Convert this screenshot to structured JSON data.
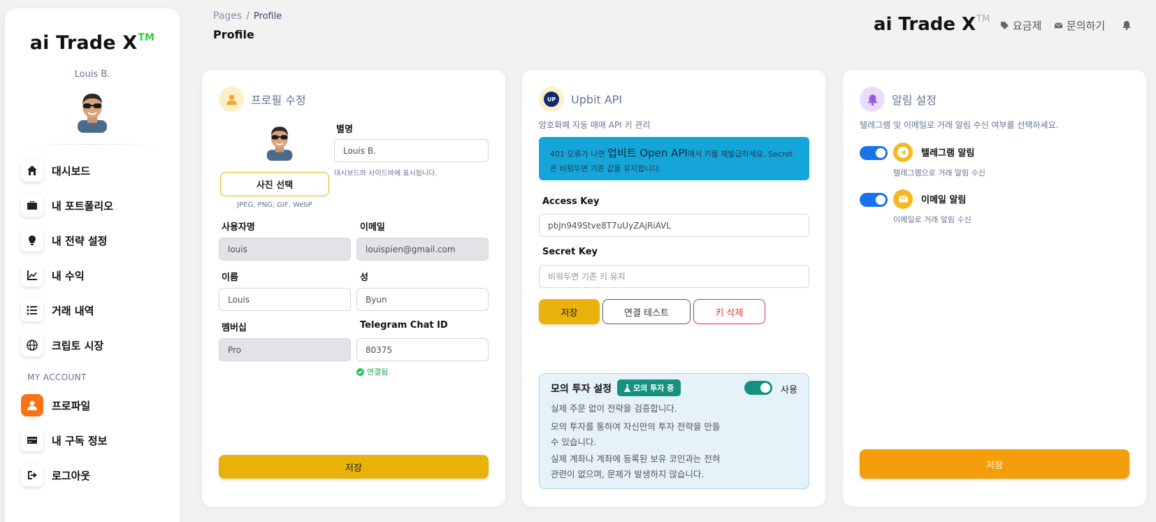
{
  "sidebar": {
    "brand": "ai Trade X",
    "brand_tm": "TM",
    "user_name": "Louis B.",
    "nav": [
      {
        "label": "대시보드",
        "icon": "home-icon"
      },
      {
        "label": "내 포트폴리오",
        "icon": "briefcase-icon"
      },
      {
        "label": "내 전략 설정",
        "icon": "lightbulb-icon"
      },
      {
        "label": "내 수익",
        "icon": "chart-line-icon"
      },
      {
        "label": "거래 내역",
        "icon": "list-icon"
      },
      {
        "label": "크립토 시장",
        "icon": "globe-icon"
      }
    ],
    "section": "MY ACCOUNT",
    "account": [
      {
        "label": "프로파일",
        "icon": "user-icon",
        "active": true
      },
      {
        "label": "내 구독 정보",
        "icon": "credit-card-icon"
      },
      {
        "label": "로그아웃",
        "icon": "logout-icon"
      }
    ]
  },
  "header": {
    "crumb_root": "Pages",
    "crumb_sep": "/",
    "crumb_current": "Profile",
    "page_title": "Profile",
    "brand": "ai Trade X",
    "brand_tm": "TM",
    "pricing": "요금제",
    "contact": "문의하기"
  },
  "profile": {
    "title": "프로필 수정",
    "nickname_label": "별명",
    "nickname_value": "Louis B.",
    "nickname_hint": "대시보드와 사이드바에 표시됩니다.",
    "photo_button": "사진 선택",
    "photo_hint": "JPEG, PNG, GIF, WebP",
    "username_label": "사용자명",
    "username_value": "louis",
    "email_label": "이메일",
    "email_value": "louispien@gmail.com",
    "first_name_label": "이름",
    "first_name_value": "Louis",
    "last_name_label": "성",
    "last_name_value": "Byun",
    "membership_label": "멤버십",
    "membership_value": "Pro",
    "telegram_label": "Telegram Chat ID",
    "telegram_value": "80375",
    "telegram_status": "연결됨",
    "save": "저장"
  },
  "upbit": {
    "title": "Upbit API",
    "logo_text": "UP",
    "subtitle": "암호화폐 자동 매매 API 키 관리",
    "alert_a": "401 오류가 나면 ",
    "alert_b": "업비트 Open API",
    "alert_c": "에서 키를 재발급하세요. Secret은 비워두면 기존 값을 유지합니다.",
    "access_label": "Access Key",
    "access_value": "pbJn949Stve8T7uUyZAjRiAVL",
    "secret_label": "Secret Key",
    "secret_placeholder": "비워두면 기존 키 유지",
    "save": "저장",
    "test": "연결 테스트",
    "delete": "키 삭제",
    "sim_title": "모의 투자 설정",
    "sim_badge": "모의 투자 중",
    "sim_toggle_label": "사용",
    "sim_desc1": "실제 주문 없이 전략을 검증합니다.",
    "sim_desc2": "모의 투자를 통하여 자신만의 투자 전략을 만들 수 있습니다.",
    "sim_desc3": "실제 계좌나 계좌에 등록된 보유 코인과는 전혀 관련이 없으며, 문제가 발생하지 않습니다."
  },
  "alerts": {
    "title": "알림 설정",
    "subtitle": "텔레그램 및 이메일로 거래 알림 수신 여부를 선택하세요.",
    "telegram_label": "텔레그램 알림",
    "telegram_desc": "텔레그램으로 거래 알림 수신",
    "email_label": "이메일 알림",
    "email_desc": "이메일로 거래 알림 수신",
    "save": "저장"
  },
  "colors": {
    "accent_orange": "#f97316",
    "save_yellow": "#e8b20a",
    "save_orange": "#f59e0b",
    "toggle_blue": "#1a73e8",
    "toggle_teal": "#14917f",
    "alert_blue": "#16a5d9"
  }
}
